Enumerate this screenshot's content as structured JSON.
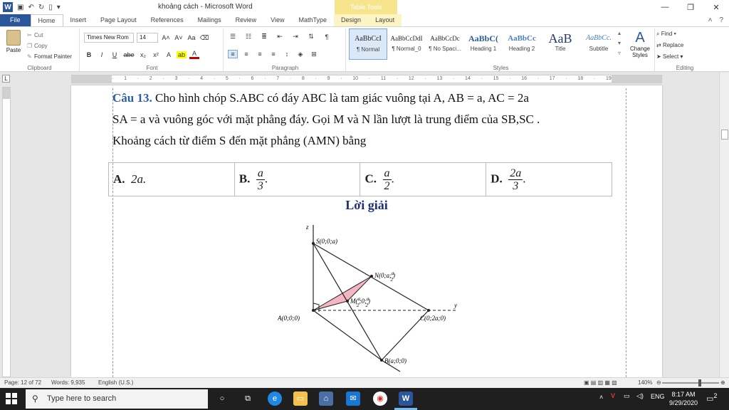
{
  "window": {
    "title": "khoảng cách  -  Microsoft Word",
    "context_tab_group": "Table Tools"
  },
  "tabs": [
    {
      "label": "File"
    },
    {
      "label": "Home"
    },
    {
      "label": "Insert"
    },
    {
      "label": "Page Layout"
    },
    {
      "label": "References"
    },
    {
      "label": "Mailings"
    },
    {
      "label": "Review"
    },
    {
      "label": "View"
    },
    {
      "label": "MathType"
    },
    {
      "label": "Design"
    },
    {
      "label": "Layout"
    }
  ],
  "ribbon": {
    "clipboard": {
      "paste": "Paste",
      "cut": "Cut",
      "copy": "Copy",
      "format_painter": "Format Painter",
      "label": "Clipboard"
    },
    "font": {
      "name": "Times New Rom",
      "size": "14",
      "label": "Font",
      "bold": "B",
      "italic": "I",
      "underline": "U",
      "strike": "abe",
      "sub": "x₂",
      "sup": "x²",
      "grow": "A˄",
      "shrink": "A˅",
      "case": "Aa",
      "highlight": "ab",
      "color": "A"
    },
    "paragraph": {
      "label": "Paragraph"
    },
    "styles": {
      "label": "Styles",
      "items": [
        {
          "preview": "AaBbCcI",
          "name": "¶ Normal"
        },
        {
          "preview": "AaBbCcDdI",
          "name": "¶ Normal_0"
        },
        {
          "preview": "AaBbCcDc",
          "name": "¶ No Spaci..."
        },
        {
          "preview": "AaBbC(",
          "name": "Heading 1"
        },
        {
          "preview": "AaBbCc",
          "name": "Heading 2"
        },
        {
          "preview": "AaB",
          "name": "Title"
        },
        {
          "preview": "AaBbCc.",
          "name": "Subtitle"
        }
      ],
      "change_styles": "Change Styles"
    },
    "editing": {
      "label": "Editing",
      "find": "Find",
      "replace": "Replace",
      "select": "Select"
    }
  },
  "document": {
    "question_label": "Câu 13.",
    "line1": "Cho hình chóp S.ABC có đáy ABC là tam giác vuông tại  A,  AB = a, AC = 2a",
    "line2": "SA = a  và vuông góc với mặt phẳng đáy. Gọi  M  và  N  lần lượt là trung điểm của  SB,SC .",
    "line3": "Khoảng cách từ điểm  S  đến mặt phẳng (AMN) bằng",
    "answers": {
      "a_label": "A.",
      "a_value": "2a.",
      "b_label": "B.",
      "b_num": "a",
      "b_den": "3",
      "c_label": "C.",
      "c_num": "a",
      "c_den": "2",
      "d_label": "D.",
      "d_num": "2a",
      "d_den": "3"
    },
    "solution_title": "Lời giải",
    "figure_labels": {
      "z": "z",
      "y": "y",
      "S": "S(0;0;a)",
      "N_pre": "N(0;a;",
      "M_pre": "M(",
      "M_mid": ";0;",
      "A": "A(0;0;0)",
      "C": "C(0;2a;0)",
      "B": "B(a;0;0)",
      "frac_a": "a",
      "frac_2": "2",
      "close": ")"
    }
  },
  "status": {
    "page": "Page: 12 of 72",
    "words": "Words: 9,935",
    "language": "English (U.S.)",
    "zoom": "140%"
  },
  "taskbar": {
    "search_placeholder": "Type here to search",
    "lang": "ENG",
    "time": "8:17 AM",
    "date": "9/29/2020",
    "notif_count": "2"
  }
}
